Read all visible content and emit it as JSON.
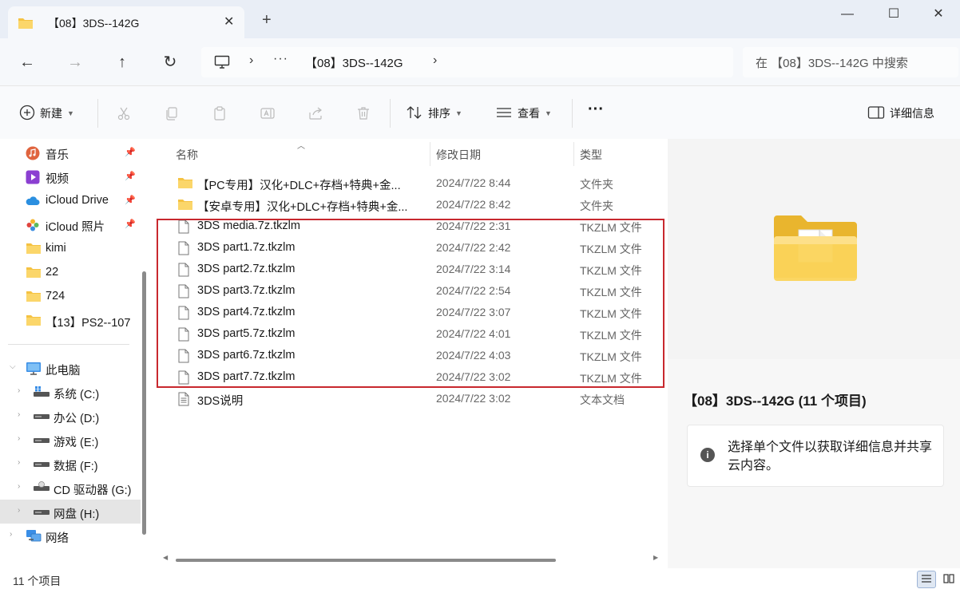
{
  "window": {
    "tab_title": "【08】3DS--142G",
    "tab_close": "✕",
    "new_tab": "+",
    "minimize": "—",
    "maximize": "☐",
    "close": "✕"
  },
  "address": {
    "back": "←",
    "forward": "→",
    "up": "↑",
    "refresh": "↻",
    "chevron": "›",
    "more": "···",
    "current": "【08】3DS--142G",
    "search_placeholder": "在 【08】3DS--142G 中搜索"
  },
  "toolbar": {
    "new_label": "新建",
    "sort_label": "排序",
    "view_label": "查看",
    "more": "···",
    "details_label": "详细信息"
  },
  "sidebar": {
    "items": [
      {
        "label": "音乐",
        "icon": "music-icon",
        "pinned": true
      },
      {
        "label": "视频",
        "icon": "video-icon",
        "pinned": true
      },
      {
        "label": "iCloud Drive",
        "icon": "icloud-icon",
        "pinned": true
      },
      {
        "label": "iCloud 照片",
        "icon": "photos-icon",
        "pinned": true
      },
      {
        "label": "kimi",
        "icon": "folder-icon"
      },
      {
        "label": "22",
        "icon": "folder-icon"
      },
      {
        "label": "724",
        "icon": "folder-icon"
      },
      {
        "label": "【13】PS2--107",
        "icon": "folder-icon"
      }
    ],
    "tree": [
      {
        "label": "此电脑",
        "icon": "pc-icon",
        "expanded": true
      },
      {
        "label": "系统 (C:)",
        "icon": "windows-drive-icon"
      },
      {
        "label": "办公 (D:)",
        "icon": "drive-icon"
      },
      {
        "label": "游戏 (E:)",
        "icon": "drive-icon"
      },
      {
        "label": "数据 (F:)",
        "icon": "drive-icon"
      },
      {
        "label": "CD 驱动器 (G:)",
        "icon": "cd-drive-icon"
      },
      {
        "label": "网盘 (H:)",
        "icon": "drive-icon",
        "selected": true
      },
      {
        "label": "网络",
        "icon": "network-icon"
      }
    ]
  },
  "filelist": {
    "headers": {
      "name": "名称",
      "date": "修改日期",
      "type": "类型"
    },
    "rows": [
      {
        "name": "【PC专用】汉化+DLC+存档+特典+金...",
        "date": "2024/7/22 8:44",
        "type": "文件夹",
        "icon": "folder-icon"
      },
      {
        "name": "【安卓专用】汉化+DLC+存档+特典+金...",
        "date": "2024/7/22 8:42",
        "type": "文件夹",
        "icon": "folder-icon"
      },
      {
        "name": "3DS media.7z.tkzlm",
        "date": "2024/7/22 2:31",
        "type": "TKZLM 文件",
        "icon": "file-icon"
      },
      {
        "name": "3DS part1.7z.tkzlm",
        "date": "2024/7/22 2:42",
        "type": "TKZLM 文件",
        "icon": "file-icon"
      },
      {
        "name": "3DS part2.7z.tkzlm",
        "date": "2024/7/22 3:14",
        "type": "TKZLM 文件",
        "icon": "file-icon"
      },
      {
        "name": "3DS part3.7z.tkzlm",
        "date": "2024/7/22 2:54",
        "type": "TKZLM 文件",
        "icon": "file-icon"
      },
      {
        "name": "3DS part4.7z.tkzlm",
        "date": "2024/7/22 3:07",
        "type": "TKZLM 文件",
        "icon": "file-icon"
      },
      {
        "name": "3DS part5.7z.tkzlm",
        "date": "2024/7/22 4:01",
        "type": "TKZLM 文件",
        "icon": "file-icon"
      },
      {
        "name": "3DS part6.7z.tkzlm",
        "date": "2024/7/22 4:03",
        "type": "TKZLM 文件",
        "icon": "file-icon"
      },
      {
        "name": "3DS part7.7z.tkzlm",
        "date": "2024/7/22 3:02",
        "type": "TKZLM 文件",
        "icon": "file-icon"
      },
      {
        "name": "3DS说明",
        "date": "2024/7/22 3:02",
        "type": "文本文档",
        "icon": "text-file-icon"
      }
    ]
  },
  "details": {
    "title": "【08】3DS--142G (11 个项目)",
    "info": "选择单个文件以获取详细信息并共享云内容。",
    "info_icon": "i"
  },
  "status": {
    "count": "11 个项目"
  },
  "colors": {
    "folder": "#f5c242",
    "highlight_box": "#c8282e",
    "accent": "#0067c0"
  }
}
